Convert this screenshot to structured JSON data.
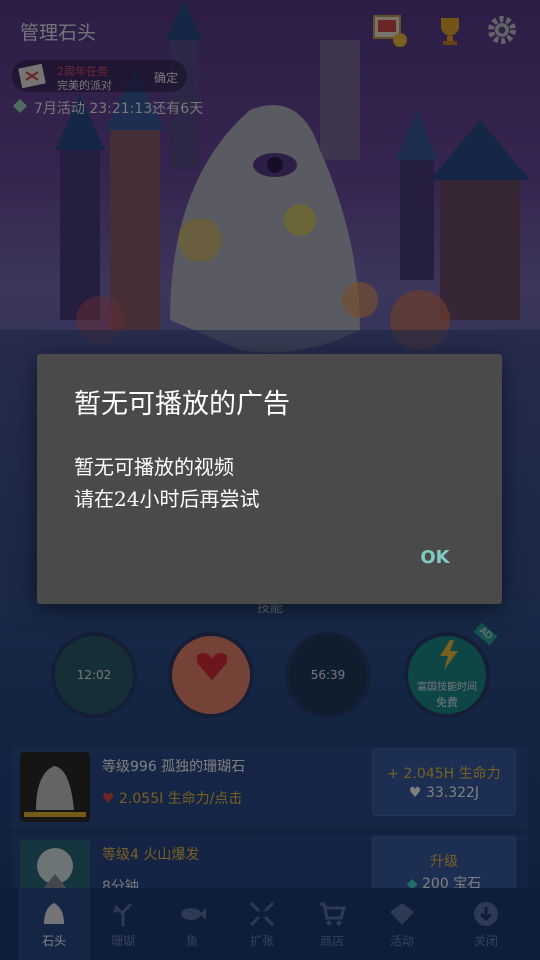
{
  "header": {
    "title": "管理石头",
    "icons": [
      "photo-badge-icon",
      "trophy-icon",
      "gear-icon"
    ]
  },
  "quest": {
    "line1": "2周年任务",
    "line2": "完美的派对",
    "confirm": "确定"
  },
  "event": {
    "text": "7月活动 23:21:13还有6天"
  },
  "skills": {
    "label": "技能",
    "items": [
      {
        "name": "skill-timer-1",
        "text": "12:02"
      },
      {
        "name": "skill-heart",
        "text": ""
      },
      {
        "name": "skill-timer-2",
        "text": "56:39"
      },
      {
        "name": "skill-boost",
        "line1": "富国技能时间",
        "line2": "免费",
        "badge": "AD"
      }
    ]
  },
  "rows": [
    {
      "title": "等级996 孤独的珊瑚石",
      "sub_value": "2.055I",
      "sub_suffix": " 生命力/点击",
      "btn_line1": "+ 2.045H 生命力",
      "btn_line2": "33.322J"
    },
    {
      "title": "等级4 火山爆发",
      "sub_value": "8分钟",
      "btn_line1": "升级",
      "btn_line2": "200 宝石"
    }
  ],
  "nav": [
    {
      "label": "石头",
      "icon": "stone-icon",
      "active": true
    },
    {
      "label": "珊瑚",
      "icon": "coral-icon"
    },
    {
      "label": "鱼",
      "icon": "fish-icon"
    },
    {
      "label": "扩张",
      "icon": "expand-icon"
    },
    {
      "label": "商店",
      "icon": "cart-icon"
    },
    {
      "label": "活动",
      "icon": "event-icon"
    },
    {
      "label": "关闭",
      "icon": "download-icon"
    }
  ],
  "dialog": {
    "title": "暂无可播放的广告",
    "message_line1": "暂无可播放的视频",
    "message_line2": "请在24小时后再尝试",
    "ok": "OK"
  },
  "colors": {
    "dialog_bg": "#4a4a4a",
    "ok_accent": "#80cbc4",
    "gold": "#f2c040",
    "nav_bg": "#1e3a7a"
  }
}
